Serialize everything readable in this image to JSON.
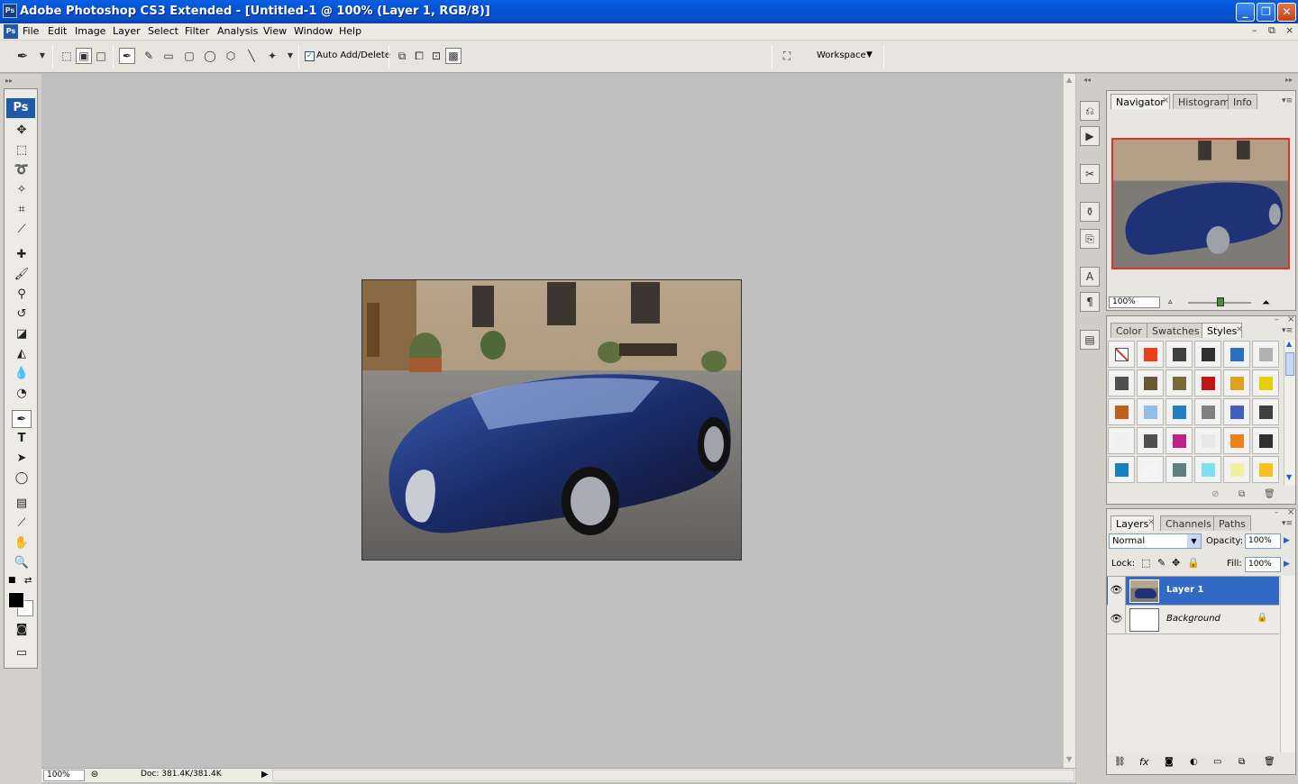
{
  "window": {
    "title": "Adobe Photoshop CS3 Extended - [Untitled-1 @ 100% (Layer 1, RGB/8)]",
    "app_icon": "Ps",
    "controls": {
      "minimize": "_",
      "restore": "❐",
      "close": "✕"
    }
  },
  "menubar": {
    "items": [
      "File",
      "Edit",
      "Image",
      "Layer",
      "Select",
      "Filter",
      "Analysis",
      "View",
      "Window",
      "Help"
    ],
    "doc_controls": {
      "minimize": "–",
      "restore": "⧉",
      "close": "×"
    }
  },
  "options": {
    "auto_add_delete_label": "Auto Add/Delete",
    "auto_add_delete_checked": true,
    "workspace_label": "Workspace"
  },
  "tools": {
    "logo": "Ps",
    "items": [
      "move-tool",
      "rectangular-marquee-tool",
      "lasso-tool",
      "magic-wand-tool",
      "crop-tool",
      "slice-tool",
      "healing-brush-tool",
      "brush-tool",
      "clone-stamp-tool",
      "history-brush-tool",
      "eraser-tool",
      "paint-bucket-tool",
      "blur-tool",
      "dodge-tool",
      "pen-tool",
      "type-tool",
      "path-selection-tool",
      "ellipse-tool",
      "notes-tool",
      "eyedropper-tool",
      "hand-tool",
      "zoom-tool"
    ],
    "active": "pen-tool"
  },
  "status": {
    "zoom": "100%",
    "doc_info": "Doc: 381.4K/381.4K"
  },
  "navigator": {
    "tabs": [
      "Navigator",
      "Histogram",
      "Info"
    ],
    "active": "Navigator",
    "zoom": "100%"
  },
  "styles_panel": {
    "tabs": [
      "Color",
      "Swatches",
      "Styles"
    ],
    "active": "Styles",
    "swatch_colors": [
      [
        "none",
        "#e8401a",
        "#404040",
        "#303030",
        "#2a6fc0",
        "#b0b0b0"
      ],
      [
        "#505050",
        "#6a5a30",
        "#7a6a35",
        "#c01818",
        "#e0a020",
        "#e8d000"
      ],
      [
        "#c06020",
        "#90c0e8",
        "#2080c0",
        "#808080",
        "#4060c0",
        "#404040"
      ],
      [
        "#f0f0f0",
        "#505050",
        "#c0208a",
        "#e8e8e8",
        "#f08018",
        "#303030"
      ],
      [
        "#1880c0",
        "#f4f4f4",
        "#608080",
        "#80e0f0",
        "#f0f0a0",
        "#f8c020"
      ]
    ]
  },
  "layers_panel": {
    "tabs": [
      "Layers",
      "Channels",
      "Paths"
    ],
    "active": "Layers",
    "blend_mode": "Normal",
    "opacity_label": "Opacity:",
    "opacity": "100%",
    "lock_label": "Lock:",
    "fill_label": "Fill:",
    "fill": "100%",
    "layers": [
      {
        "name": "Layer 1",
        "selected": true,
        "visible": true
      },
      {
        "name": "Background",
        "selected": false,
        "visible": true,
        "locked": true
      }
    ]
  },
  "colors": {
    "title_bar": "#0453d6",
    "selection": "#316ac5",
    "canvas_bg": "#c0c0c0",
    "panel_bg": "#e8e6e0"
  }
}
